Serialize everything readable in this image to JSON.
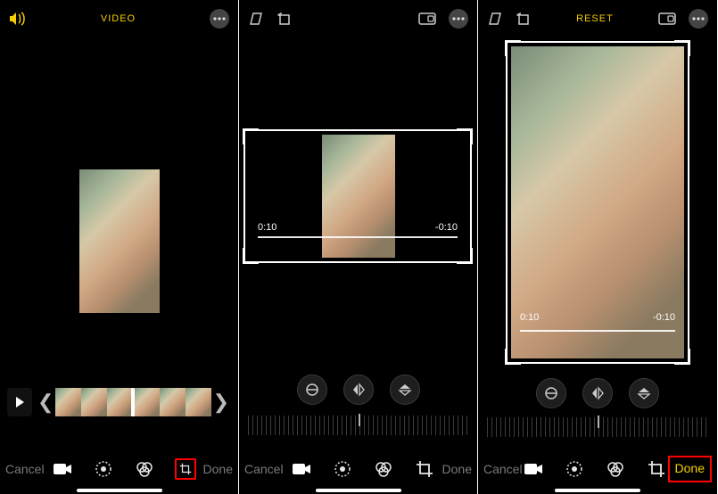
{
  "pane1": {
    "title": "VIDEO",
    "cancel": "Cancel",
    "done": "Done"
  },
  "pane2": {
    "cancel": "Cancel",
    "done": "Done",
    "time_start": "0:10",
    "time_end": "-0:10"
  },
  "pane3": {
    "reset": "RESET",
    "cancel": "Cancel",
    "done": "Done",
    "time_start": "0:10",
    "time_end": "-0:10"
  },
  "colors": {
    "accent": "#f7ce00",
    "highlight": "#ff0000"
  },
  "icons": {
    "volume": "volume-icon",
    "more": "more-icon",
    "skew": "skew-icon",
    "rotate": "rotate-icon",
    "aspect": "aspect-icon",
    "play": "play-icon",
    "video": "video-mode-icon",
    "adjust": "adjust-icon",
    "filters": "filters-icon",
    "crop": "crop-icon",
    "straighten": "straighten-icon",
    "flip_h": "flip-horizontal-icon",
    "flip_v": "flip-vertical-icon"
  }
}
